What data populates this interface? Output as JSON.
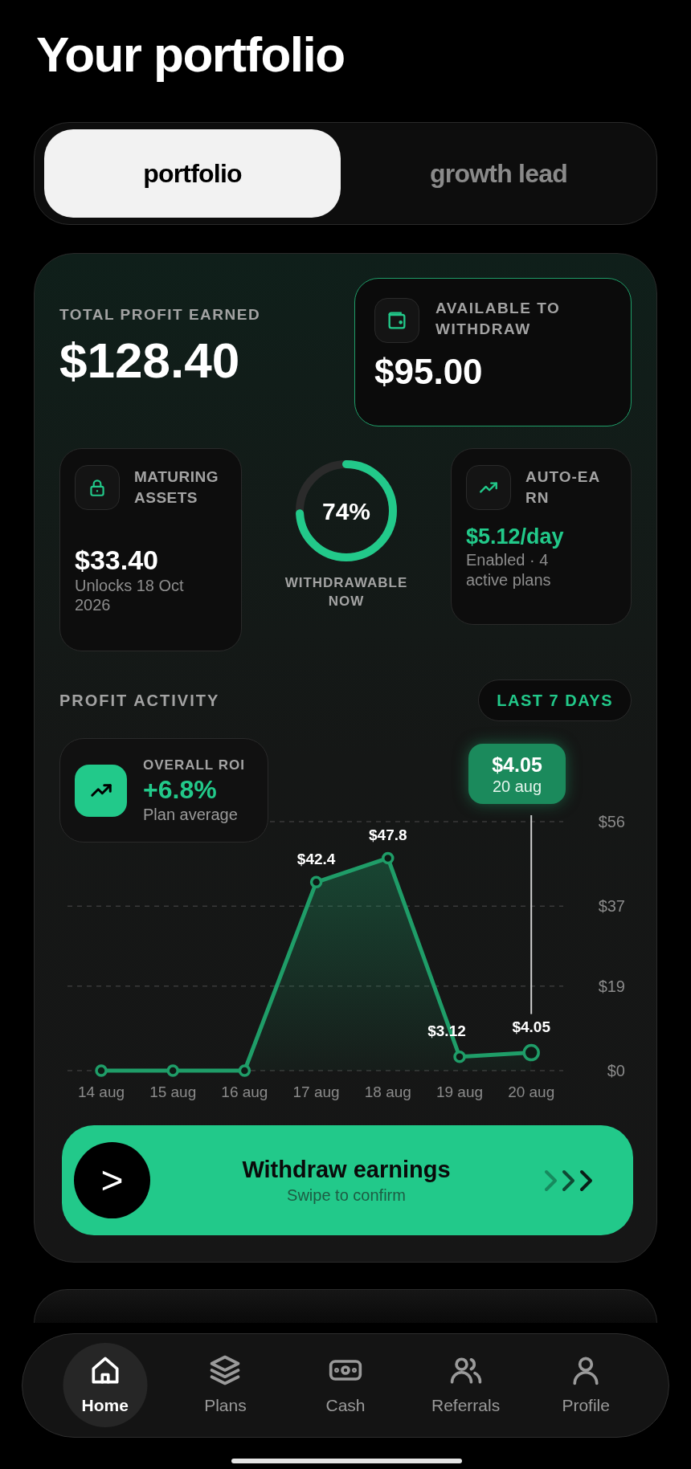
{
  "title": "Your portfolio",
  "tabs": [
    {
      "label": "portfolio",
      "selected": true
    },
    {
      "label": "growth lead",
      "selected": false
    }
  ],
  "summary": {
    "total": {
      "label": "TOTAL PROFIT EARNED",
      "amount": "$128.40"
    },
    "available": {
      "label": "AVAILABLE TO WITHDRAW",
      "amount": "$95.00"
    },
    "maturing": {
      "label": "MATURING ASSETS",
      "amount": "$33.40",
      "note": "Unlocks 18 Oct 2026"
    },
    "ring": {
      "value": "74%",
      "level": 0.74,
      "label": "WITHDRAWABLE NOW"
    },
    "auto_earn": {
      "label": "AUTO-EARN",
      "rate": "$5.12/day",
      "note": "Enabled · 4 active plans"
    }
  },
  "activity": {
    "title": "PROFIT ACTIVITY",
    "range": "LAST 7 DAYS",
    "roi": {
      "label": "OVERALL ROI",
      "value": "+6.8%",
      "note": "Plan average"
    },
    "tooltip": {
      "value": "$4.05",
      "date": "20 aug"
    },
    "chart_data": {
      "type": "line",
      "categories": [
        "14 aug",
        "15 aug",
        "16 aug",
        "17 aug",
        "18 aug",
        "19 aug",
        "20 aug"
      ],
      "series": [
        {
          "color": "#1f9d68",
          "marker": true,
          "values": [
            0,
            0,
            0,
            42.4,
            47.8,
            3.12,
            4.05
          ]
        }
      ],
      "ref_lines": [
        {
          "axis": "x",
          "value": "20 aug"
        }
      ],
      "value_labels": [
        null,
        null,
        null,
        "$42.4",
        "$47.8",
        "$3.12",
        "$4.05"
      ],
      "ylim": [
        0,
        56
      ],
      "yticks": [
        {
          "value": 0,
          "label": "$0"
        },
        {
          "value": 19,
          "label": "$19"
        },
        {
          "value": 37,
          "label": "$37"
        },
        {
          "value": 56,
          "label": "$56"
        }
      ]
    }
  },
  "swipe": {
    "handle": ">",
    "level": 0,
    "title": "Withdraw earnings",
    "subtitle": "Swipe to confirm"
  },
  "nav": [
    {
      "label": "Home",
      "kind": "home",
      "selected": true
    },
    {
      "label": "Plans",
      "kind": "plans",
      "selected": false
    },
    {
      "label": "Cash",
      "kind": "cash",
      "selected": false
    },
    {
      "label": "Referrals",
      "kind": "referrals",
      "selected": false
    },
    {
      "label": "Profile",
      "kind": "profile",
      "selected": false
    }
  ]
}
